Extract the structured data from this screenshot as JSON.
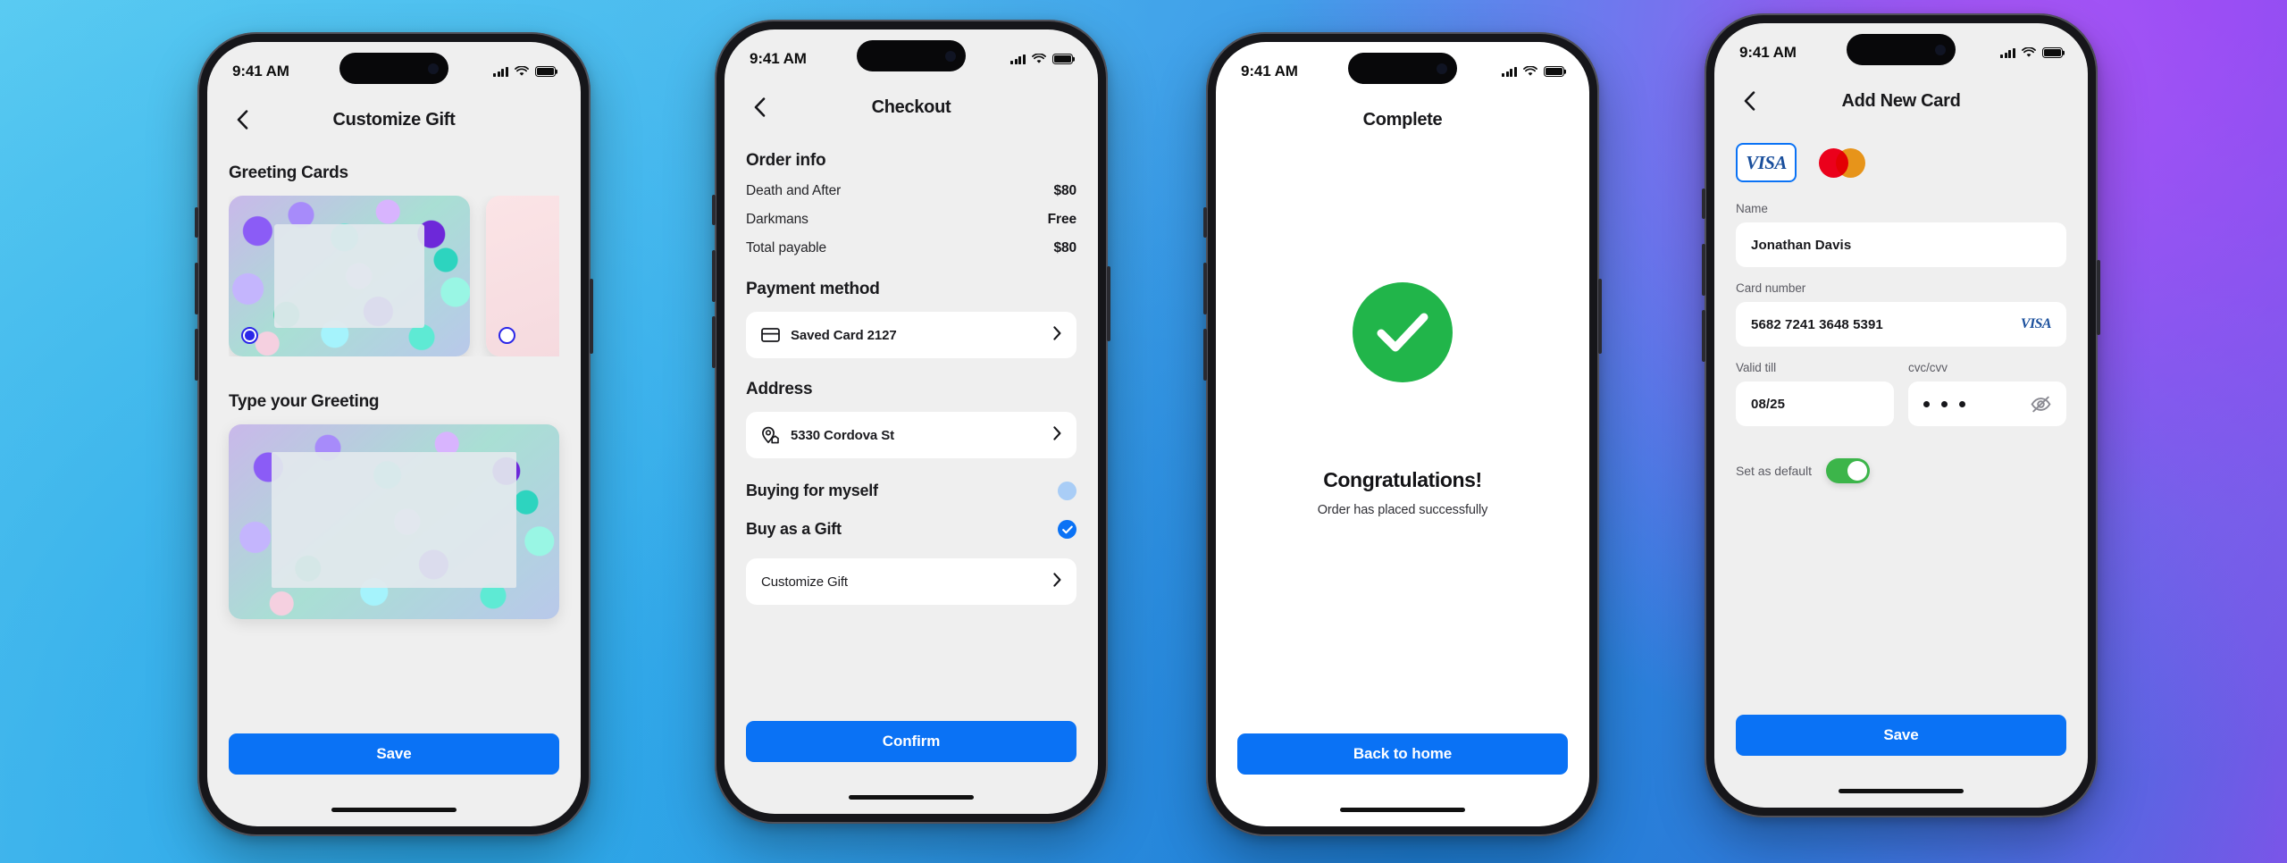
{
  "status_bar": {
    "time": "9:41 AM",
    "cellular_icon": "cellular-signal-icon",
    "wifi_icon": "wifi-icon",
    "battery_icon": "battery-icon"
  },
  "screens": [
    {
      "id": "customize-gift",
      "nav": {
        "back_icon": "chevron-left-icon",
        "title": "Customize Gift"
      },
      "sections": [
        {
          "heading": "Greeting Cards"
        },
        {
          "heading": "Type your Greeting"
        }
      ],
      "cards": [
        {
          "name": "confetti-card",
          "selected": true
        },
        {
          "name": "floral-card",
          "selected": false
        }
      ],
      "primary_button": "Save"
    },
    {
      "id": "checkout",
      "nav": {
        "back_icon": "chevron-left-icon",
        "title": "Checkout"
      },
      "order_info": {
        "heading": "Order info",
        "rows": [
          {
            "label": "Death and After",
            "value": "$80"
          },
          {
            "label": "Darkmans",
            "value": "Free"
          },
          {
            "label": "Total payable",
            "value": "$80"
          }
        ]
      },
      "payment_method": {
        "heading": "Payment method",
        "item_label": "Saved Card 2127",
        "item_icon": "credit-card-icon",
        "chevron_icon": "chevron-right-icon"
      },
      "address": {
        "heading": "Address",
        "item_label": "5330 Cordova St",
        "item_icon": "map-pin-home-icon",
        "chevron_icon": "chevron-right-icon"
      },
      "choices": [
        {
          "label": "Buying for myself",
          "selected": false
        },
        {
          "label": "Buy as a Gift",
          "selected": true
        }
      ],
      "customize_gift": {
        "label": "Customize Gift",
        "chevron_icon": "chevron-right-icon"
      },
      "primary_button": "Confirm"
    },
    {
      "id": "complete",
      "nav": {
        "title": "Complete"
      },
      "success_icon": "check-circle-icon",
      "headline": "Congratulations!",
      "subtext": "Order has placed successfully",
      "primary_button": "Back to home",
      "success_color": "#21b54a"
    },
    {
      "id": "add-new-card",
      "nav": {
        "back_icon": "chevron-left-icon",
        "title": "Add New Card"
      },
      "brands": [
        {
          "name": "visa-brand-option",
          "label": "VISA",
          "selected": true
        },
        {
          "name": "mastercard-brand-option",
          "label": "",
          "selected": false
        }
      ],
      "fields": [
        {
          "key": "name",
          "label": "Name",
          "value": "Jonathan Davis"
        },
        {
          "key": "card_number",
          "label": "Card number",
          "value": "5682 7241 3648 5391",
          "trailing_label": "VISA"
        },
        {
          "key": "valid_till",
          "label": "Valid till",
          "value": "08/25"
        },
        {
          "key": "cvc",
          "label": "cvc/cvv",
          "value": "•••",
          "trailing_icon": "eye-off-icon"
        }
      ],
      "set_default": {
        "label": "Set as default",
        "enabled": true
      },
      "primary_button": "Save"
    }
  ],
  "colors": {
    "accent_blue": "#0a72f5",
    "radio_blue": "#2b26e8",
    "success_green": "#21b54a",
    "toggle_green": "#3cb54a",
    "screen_bg": "#efefef"
  }
}
